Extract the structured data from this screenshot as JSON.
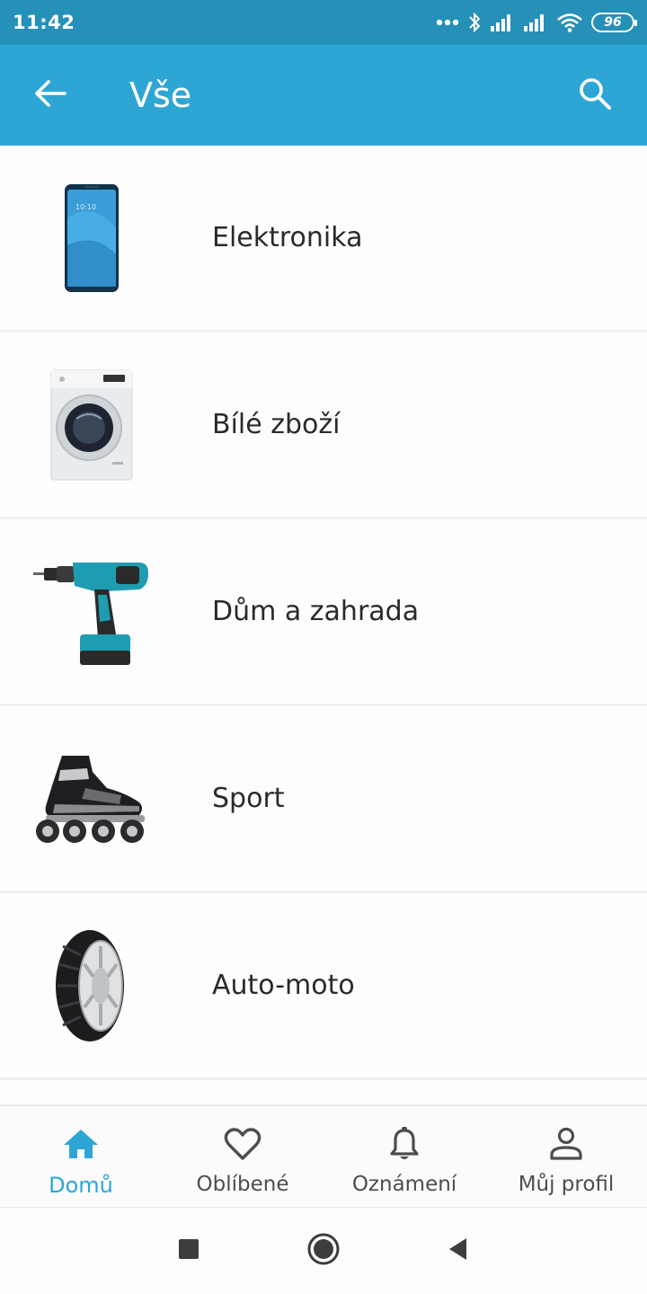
{
  "status_bar": {
    "time": "11:42",
    "battery": "96"
  },
  "app_bar": {
    "title": "Vše",
    "back_icon": "arrow-left-icon",
    "search_icon": "search-icon"
  },
  "categories": [
    {
      "label": "Elektronika",
      "icon": "smartphone-image"
    },
    {
      "label": "Bílé zboží",
      "icon": "washing-machine-image"
    },
    {
      "label": "Dům a zahrada",
      "icon": "cordless-drill-image"
    },
    {
      "label": "Sport",
      "icon": "inline-skate-image"
    },
    {
      "label": "Auto-moto",
      "icon": "tire-image"
    }
  ],
  "bottom_nav": {
    "items": [
      {
        "label": "Domů",
        "icon": "home-icon",
        "active": true
      },
      {
        "label": "Oblíbené",
        "icon": "heart-icon",
        "active": false
      },
      {
        "label": "Oznámení",
        "icon": "bell-icon",
        "active": false
      },
      {
        "label": "Můj profil",
        "icon": "person-icon",
        "active": false
      }
    ]
  },
  "colors": {
    "status_bar": "#2590b8",
    "app_bar": "#2ea6d5",
    "accent": "#2ea6d5",
    "text": "#2a2a2a",
    "nav_inactive": "#4d4d4d"
  }
}
